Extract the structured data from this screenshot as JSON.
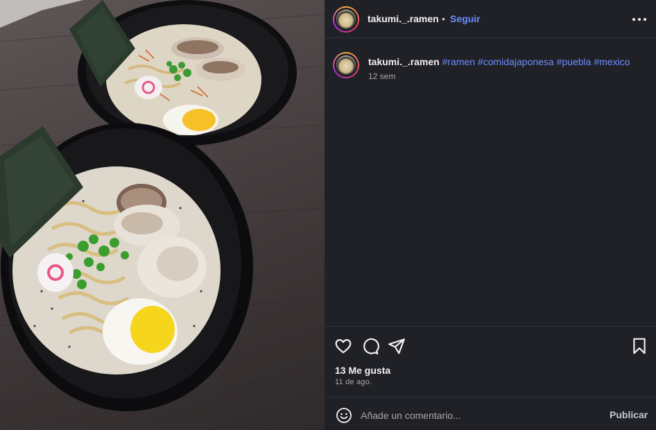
{
  "post": {
    "username": "takumi._.ramen",
    "separator": "•",
    "follow_label": "Seguir"
  },
  "caption": {
    "username": "takumi._.ramen",
    "hashtags": [
      "#ramen",
      "#comidajaponesa",
      "#puebla",
      "#mexico"
    ],
    "time": "12 sem"
  },
  "stats": {
    "likes": "13 Me gusta",
    "date": "11 de ago."
  },
  "comment": {
    "placeholder": "Añade un comentario...",
    "publish_label": "Publicar"
  },
  "icons": {
    "more": "more-options-icon",
    "like": "heart-icon",
    "comment": "comment-bubble-icon",
    "share": "paper-plane-icon",
    "save": "bookmark-icon",
    "emoji": "smiley-icon"
  },
  "colors": {
    "background": "#202126",
    "link": "#6d8cff",
    "secondary_text": "#a9a9a9"
  }
}
